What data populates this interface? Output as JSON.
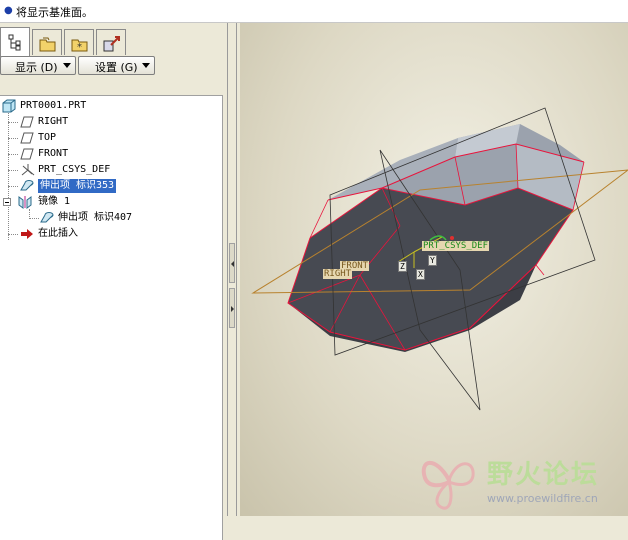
{
  "message_bar": {
    "text": "将显示基准面。"
  },
  "buttons": {
    "display": "显示 (D)",
    "settings": "设置 (G)"
  },
  "tree": {
    "root": "PRT0001.PRT",
    "items": [
      {
        "label": "RIGHT"
      },
      {
        "label": "TOP"
      },
      {
        "label": "FRONT"
      },
      {
        "label": "PRT_CSYS_DEF"
      },
      {
        "label": "伸出项 标识353"
      },
      {
        "label": "镜像 1"
      },
      {
        "label": "伸出项 标识407"
      },
      {
        "label": "在此插入"
      }
    ]
  },
  "viewport": {
    "labels": {
      "csys": "PRT_CSYS_DEF",
      "front": "FRONT",
      "right": "RIGHT",
      "axis_x": "X",
      "axis_y": "Y",
      "axis_z": "Z"
    }
  },
  "watermark": {
    "title": "野火论坛",
    "url": "www.proewildfire.cn"
  },
  "colors": {
    "selection": "#316ac5",
    "datum": "#b8822e",
    "edge": "#e8143c",
    "model_dark": "#4a4d55",
    "model_light": "#9aa1ab"
  }
}
